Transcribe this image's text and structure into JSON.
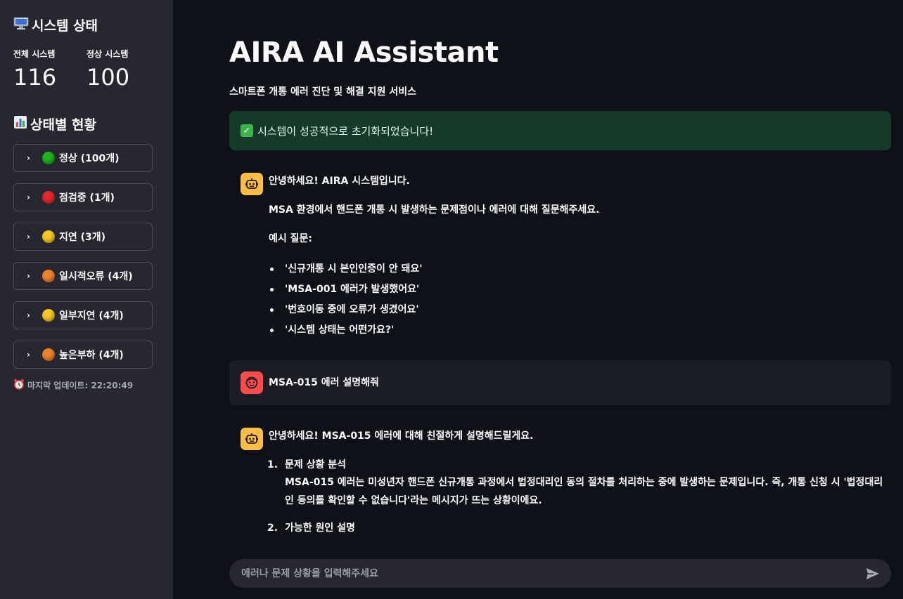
{
  "sidebar": {
    "title": "시스템 상태",
    "title_icon": "monitor-icon",
    "metrics": [
      {
        "label": "전체 시스템",
        "value": "116"
      },
      {
        "label": "정상 시스템",
        "value": "100"
      }
    ],
    "status_title": "상태별 현황",
    "status_icon": "bar-chart-icon",
    "expanders": [
      {
        "label": "정상 (100개)",
        "color": "#1fb31f"
      },
      {
        "label": "점검중 (1개)",
        "color": "#e8262c"
      },
      {
        "label": "지연 (3개)",
        "color": "#f7c623"
      },
      {
        "label": "일시적오류 (4개)",
        "color": "#f0832a"
      },
      {
        "label": "일부지연 (4개)",
        "color": "#f7c623"
      },
      {
        "label": "높은부하 (4개)",
        "color": "#f0832a"
      }
    ],
    "last_update": "마지막 업데이트: 22:20:49"
  },
  "main": {
    "title": "AIRA AI Assistant",
    "subtitle": "스마트폰 개통 에러 진단 및 해결 지원 서비스",
    "success": "시스템이 성공적으로 초기화되었습니다!",
    "messages": {
      "welcome": {
        "greeting": "안녕하세요! AIRA 시스템입니다.",
        "intro": "MSA 환경에서 핸드폰 개통 시 발생하는 문제점이나 에러에 대해 질문해주세요.",
        "examples_title": "예시 질문:",
        "examples": [
          "'신규개통 시 본인인증이 안 돼요'",
          "'MSA-001 에러가 발생했어요'",
          "'번호이동 중에 오류가 생겼어요'",
          "'시스템 상태는 어떤가요?'"
        ]
      },
      "user": {
        "text": "MSA-015 에러 설명해줘"
      },
      "answer": {
        "greeting": "안녕하세요! MSA-015 에러에 대해 친절하게 설명해드릴게요.",
        "items": [
          {
            "num": "1.",
            "title": "문제 상황 분석",
            "desc": "MSA-015 에러는 미성년자 핸드폰 신규개통 과정에서 법정대리인 동의 절차를 처리하는 중에 발생하는 문제입니다. 즉, 개통 신청 시 '법정대리인 동의를 확인할 수 없습니다'라는 메시지가 뜨는 상황이에요."
          },
          {
            "num": "2.",
            "title": "가능한 원인 설명",
            "desc": ""
          }
        ]
      }
    }
  },
  "chat_input": {
    "placeholder": "에러나 문제 상황을 입력해주세요"
  },
  "colors": {
    "accent": "#ff4b4b",
    "bot_avatar": "#ffbd45",
    "success_bg": "#163a2a"
  }
}
